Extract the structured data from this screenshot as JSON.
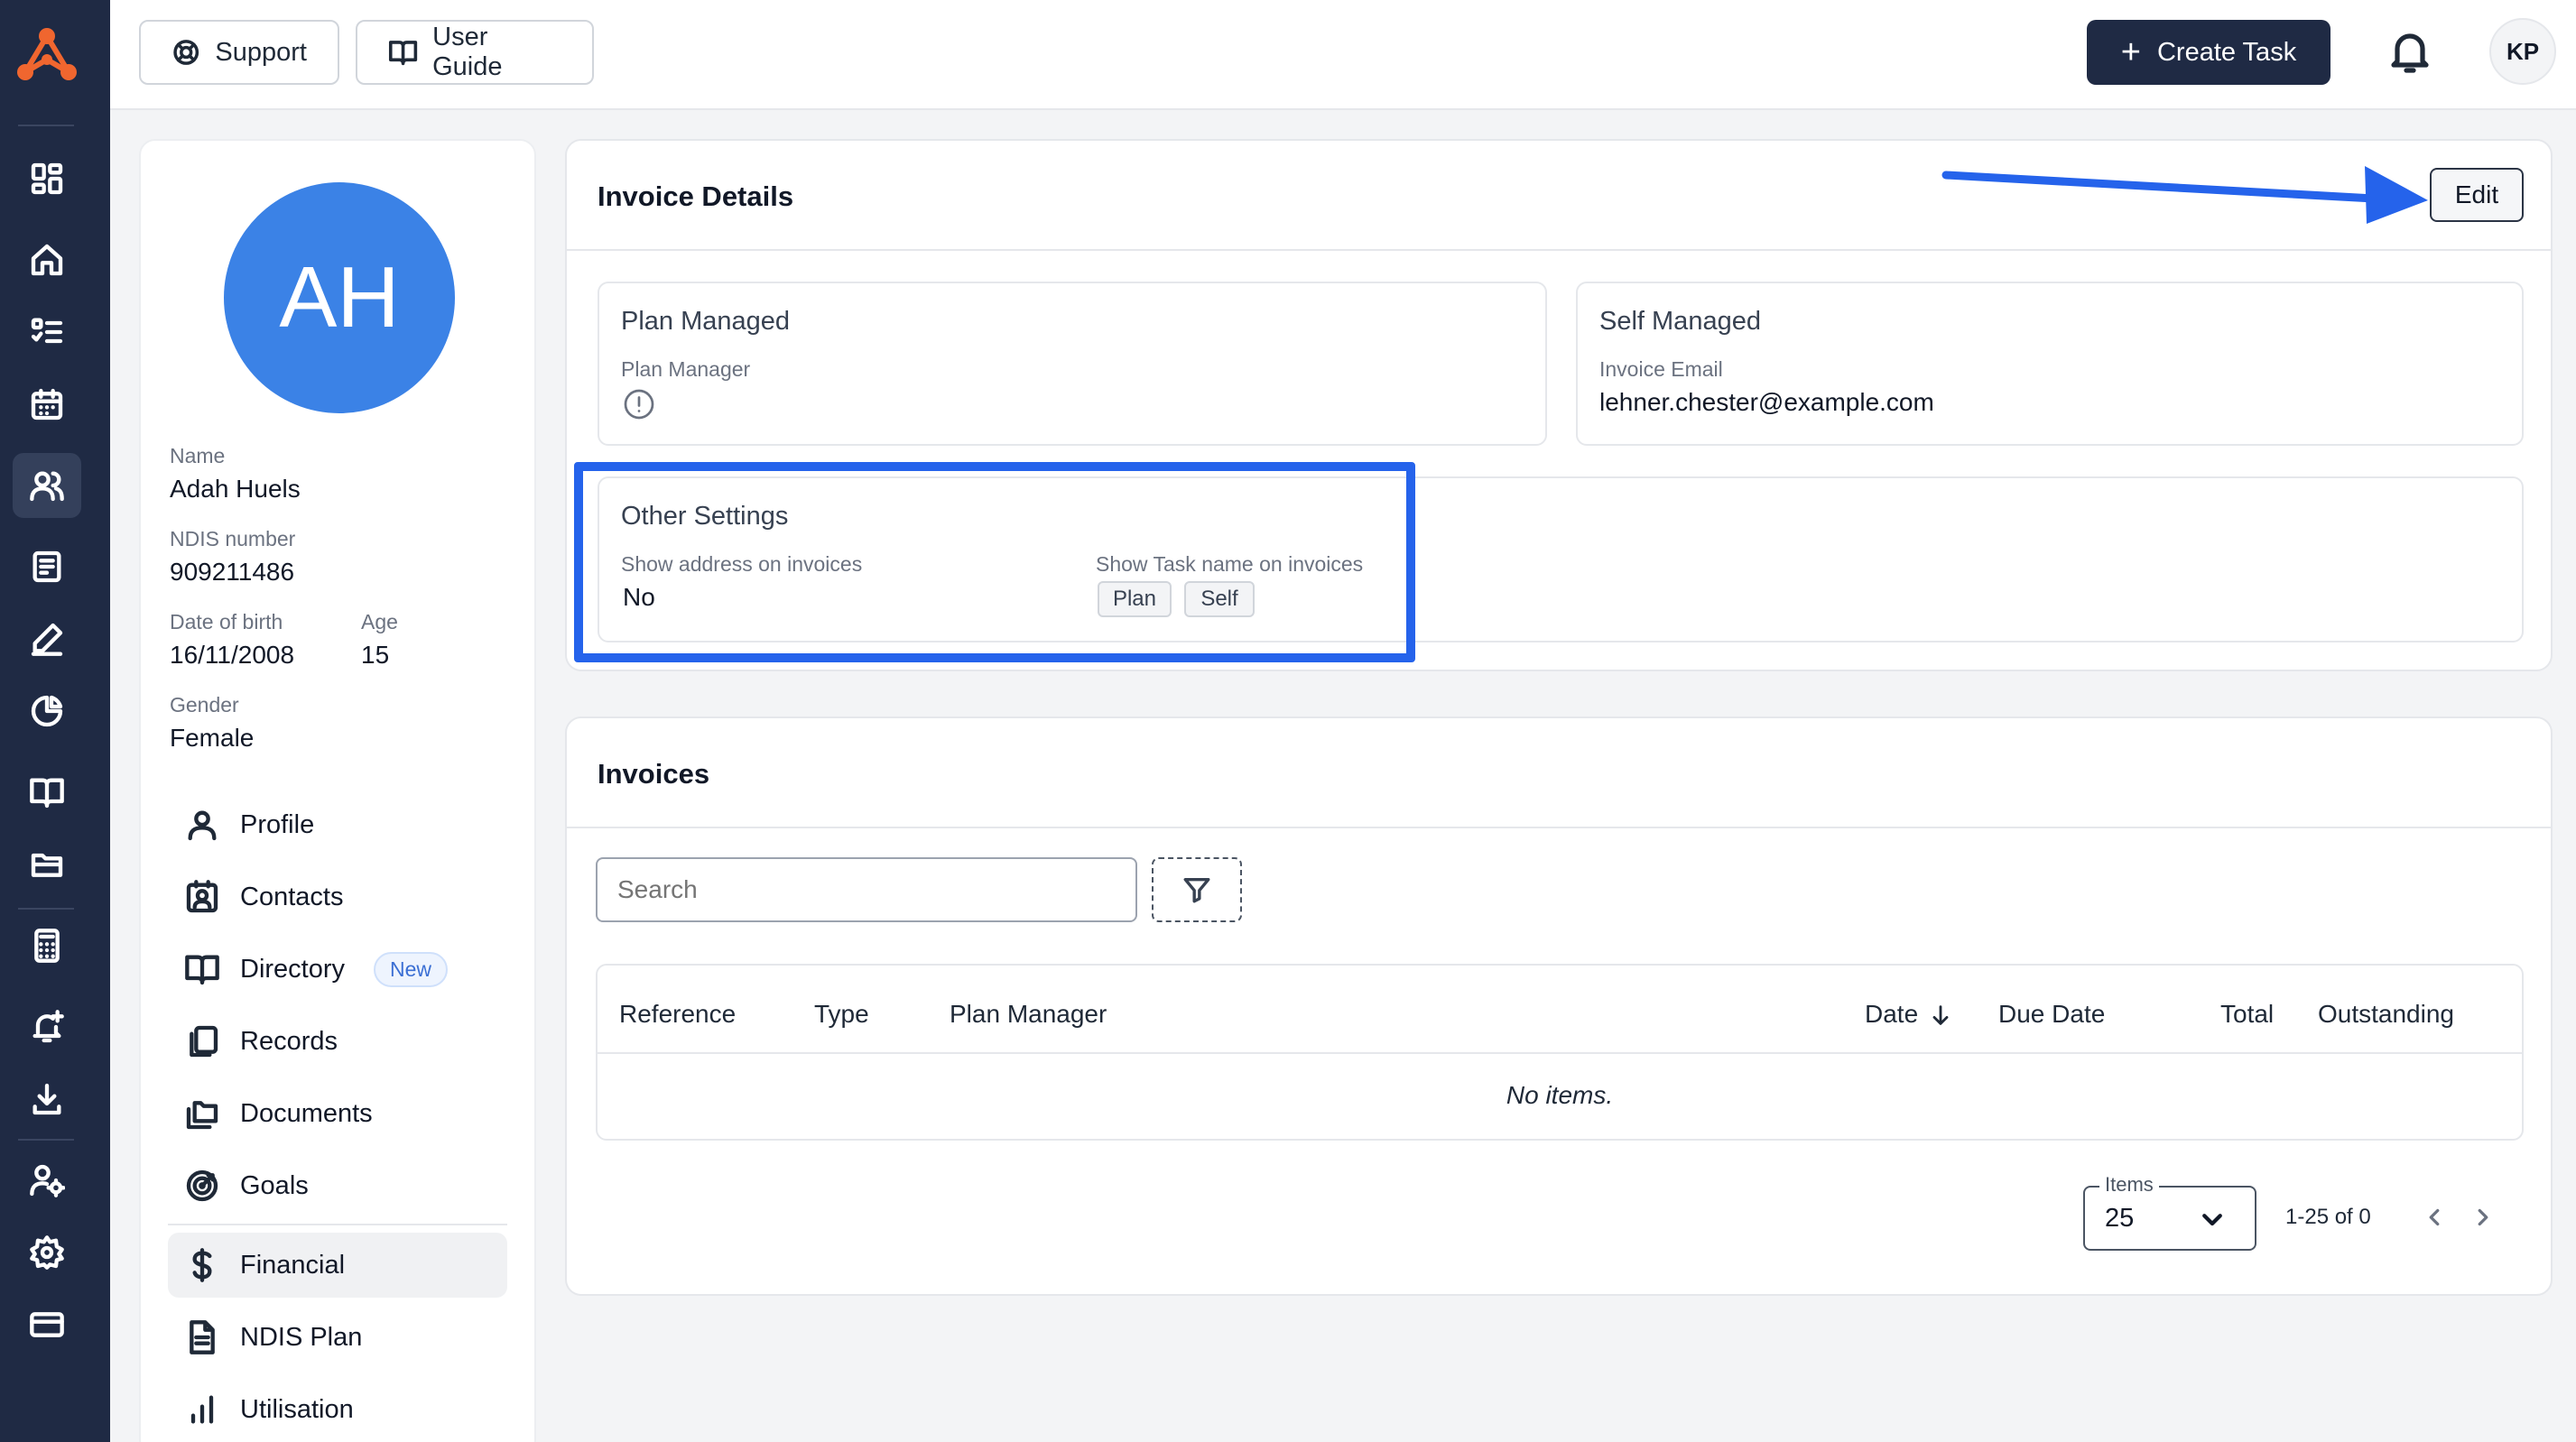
{
  "topbar": {
    "support_label": "Support",
    "user_guide_label": "User Guide",
    "create_task_label": "Create Task",
    "user_initials": "KP"
  },
  "sidebar_icons": [
    "dashboard-icon",
    "home-icon",
    "checklist-icon",
    "calendar-icon",
    "users-icon",
    "form-icon",
    "signature-icon",
    "chart-pie-icon",
    "book-icon",
    "folder-icon",
    "calculator-icon",
    "alert-bell-icon",
    "download-icon",
    "user-settings-icon",
    "gear-icon",
    "credit-card-icon"
  ],
  "client": {
    "initials": "AH",
    "name_label": "Name",
    "name": "Adah Huels",
    "ndis_label": "NDIS number",
    "ndis": "909211486",
    "dob_label": "Date of birth",
    "dob": "16/11/2008",
    "age_label": "Age",
    "age": "15",
    "gender_label": "Gender",
    "gender": "Female"
  },
  "profile_nav": [
    {
      "label": "Profile"
    },
    {
      "label": "Contacts"
    },
    {
      "label": "Directory",
      "badge": "New"
    },
    {
      "label": "Records"
    },
    {
      "label": "Documents"
    },
    {
      "label": "Goals"
    },
    {
      "label": "Financial"
    },
    {
      "label": "NDIS Plan"
    },
    {
      "label": "Utilisation"
    }
  ],
  "invoice_details": {
    "title": "Invoice Details",
    "edit_label": "Edit",
    "plan_managed": {
      "title": "Plan Managed",
      "field_label": "Plan Manager"
    },
    "self_managed": {
      "title": "Self Managed",
      "field_label": "Invoice Email",
      "field_value": "lehner.chester@example.com"
    },
    "other_settings": {
      "title": "Other Settings",
      "address_label": "Show address on invoices",
      "address_value": "No",
      "task_label": "Show Task name on invoices",
      "chips": [
        "Plan",
        "Self"
      ]
    }
  },
  "invoices": {
    "title": "Invoices",
    "search_placeholder": "Search",
    "columns": [
      "Reference",
      "Type",
      "Plan Manager",
      "Date",
      "Due Date",
      "Total",
      "Outstanding"
    ],
    "empty_text": "No items.",
    "items_label": "Items",
    "items_value": "25",
    "range": "1-25 of 0"
  },
  "colors": {
    "rail": "#1f2a44",
    "accent": "#3b82e6",
    "annotation": "#2563eb"
  }
}
